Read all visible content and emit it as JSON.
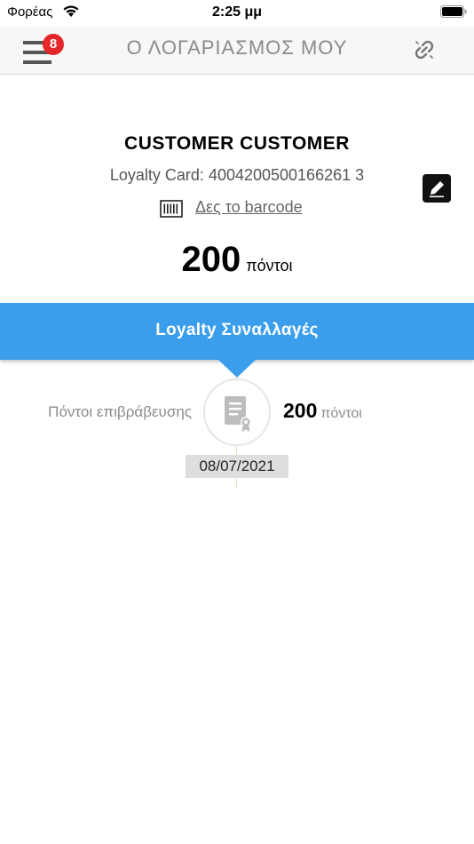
{
  "status_bar": {
    "carrier": "Φορέας",
    "time": "2:25 μμ"
  },
  "nav": {
    "title": "Ο ΛΟΓΑΡΙΑΣΜΟΣ ΜΟΥ",
    "badge_count": "8",
    "menu_icon": "hamburger-icon",
    "link_icon": "broken-link-icon"
  },
  "profile": {
    "name": "CUSTOMER CUSTOMER",
    "loyalty_card_label": "Loyalty Card:",
    "loyalty_card_number": "4004200500166261 3",
    "barcode_link": "Δες το barcode",
    "points_value": "200",
    "points_unit": "πόντοι",
    "edit_icon": "pencil-icon",
    "barcode_icon": "barcode-icon"
  },
  "banner": {
    "title": "Loyalty Συναλλαγές",
    "color": "#3b9eed"
  },
  "transactions": [
    {
      "label": "Πόντοι επιβράβευσης",
      "points_value": "200",
      "points_unit": "πόντοι",
      "date": "08/07/2021",
      "icon": "certificate-document-icon"
    }
  ]
}
